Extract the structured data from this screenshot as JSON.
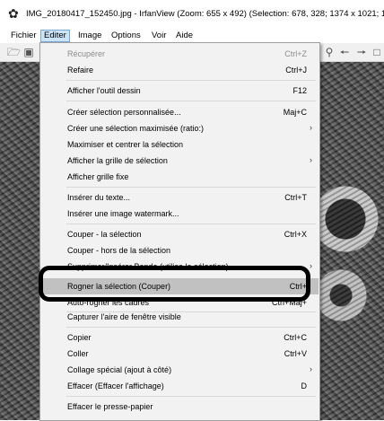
{
  "window": {
    "title": "IMG_20180417_152450.jpg - IrfanView (Zoom: 655 x 492) (Selection: 678, 328; 1374 x 1021; 1...."
  },
  "menubar": {
    "items": [
      "Fichier",
      "Editer",
      "Image",
      "Options",
      "Voir",
      "Aide"
    ]
  },
  "icons": {
    "app": "irfanview-cat-icon",
    "toolbar": [
      "open-folder-icon",
      "save-icon",
      "zoom-icon",
      "arrow-left-icon",
      "arrow-right-icon",
      "page-icon"
    ]
  },
  "edit_menu": {
    "items": [
      {
        "label": "Récupérer",
        "shortcut": "Ctrl+Z",
        "disabled": true
      },
      {
        "label": "Refaire",
        "shortcut": "Ctrl+J"
      },
      {
        "label": "Afficher l'outil dessin",
        "shortcut": "F12"
      },
      {
        "label": "Créer sélection personnalisée...",
        "shortcut": "Maj+C"
      },
      {
        "label": "Créer une sélection maximisée (ratio:)",
        "shortcut": ""
      },
      {
        "label": "Maximiser et centrer la sélection",
        "shortcut": ""
      },
      {
        "label": "Afficher la grille de sélection",
        "shortcut": ""
      },
      {
        "label": "Afficher grille fixe",
        "shortcut": ""
      },
      {
        "label": "Insérer du texte...",
        "shortcut": "Ctrl+T"
      },
      {
        "label": "Insérer une image watermark...",
        "shortcut": ""
      },
      {
        "label": "Couper - la sélection",
        "shortcut": "Ctrl+X"
      },
      {
        "label": "Couper - hors de la sélection",
        "shortcut": ""
      },
      {
        "label": "Supprimer/Insérer Bande (utilise la sélection)",
        "shortcut": ""
      },
      {
        "label": "Rogner la sélection (Couper)",
        "shortcut": "Ctrl+"
      },
      {
        "label": "Auto-rogner les cadres",
        "shortcut": "Ctrl+Maj+"
      },
      {
        "label": "Capturer l'aire de fenêtre visible",
        "shortcut": ""
      },
      {
        "label": "Copier",
        "shortcut": "Ctrl+C"
      },
      {
        "label": "Coller",
        "shortcut": "Ctrl+V"
      },
      {
        "label": "Collage spécial (ajout à côté)",
        "shortcut": ""
      },
      {
        "label": "Effacer (Effacer l'affichage)",
        "shortcut": "D"
      },
      {
        "label": "Effacer le presse-papier",
        "shortcut": ""
      }
    ]
  }
}
